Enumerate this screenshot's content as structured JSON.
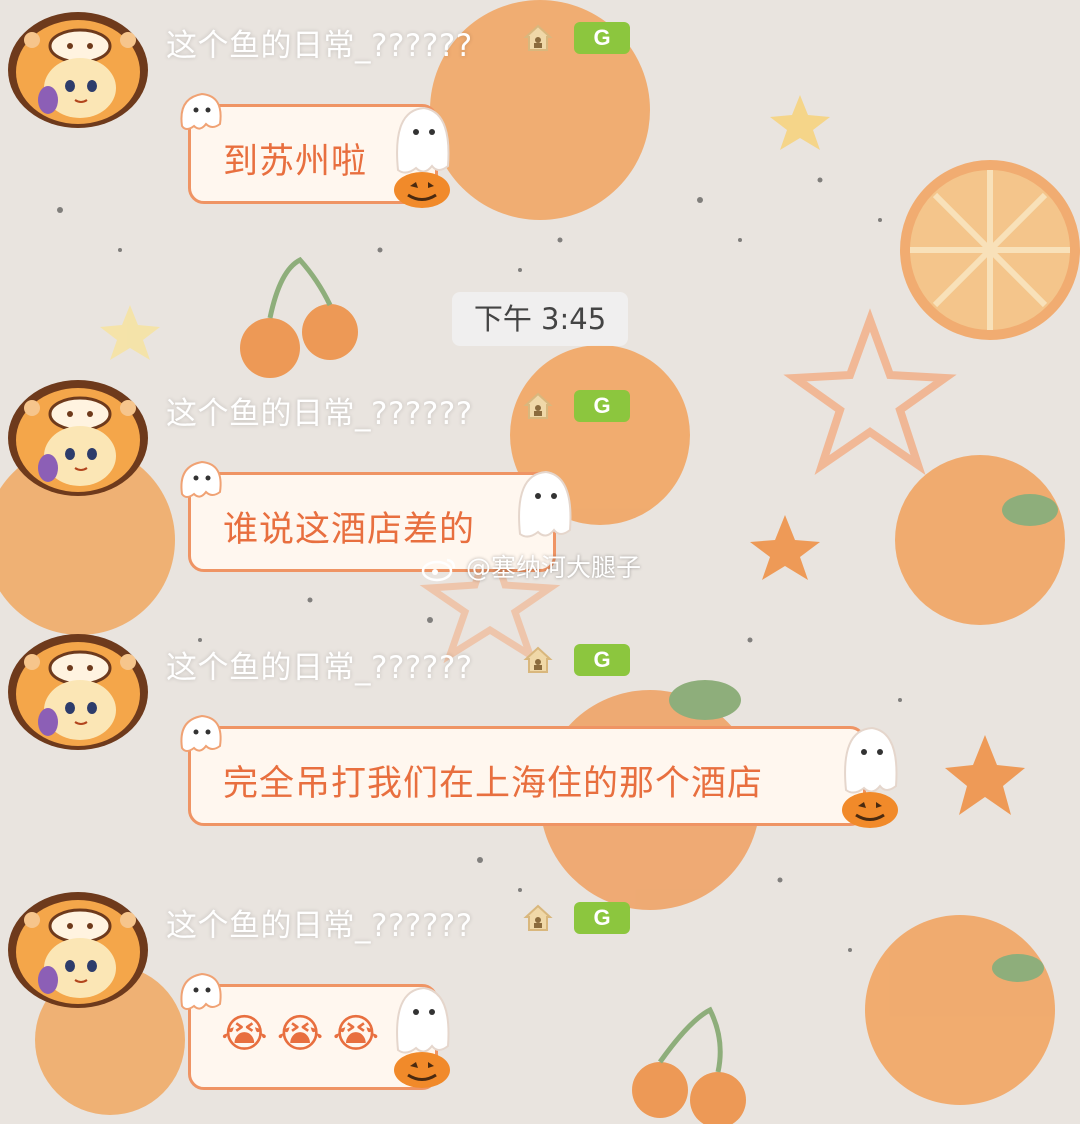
{
  "chat": {
    "timestamp": "下午 3:45",
    "messages": [
      {
        "sender": "这个鱼的日常_??????",
        "level_badge": "G",
        "text": "到苏州啦"
      },
      {
        "sender": "这个鱼的日常_??????",
        "level_badge": "G",
        "text": "谁说这酒店差的"
      },
      {
        "sender": "这个鱼的日常_??????",
        "level_badge": "G",
        "text": "完全吊打我们在上海住的那个酒店"
      },
      {
        "sender": "这个鱼的日常_??????",
        "level_badge": "G",
        "emojis": [
          "😭",
          "😭",
          "😭"
        ]
      }
    ]
  },
  "watermark": {
    "text": "@塞纳河大腿子"
  },
  "icons": {
    "avatar": "costume-avatar-icon",
    "house": "house-icon",
    "bubble_decor": "ghost-pumpkin-icon",
    "emoji": "crying-face-emoji"
  },
  "colors": {
    "bubble_border": "#ef9464",
    "bubble_fill": "#fff7ef",
    "bubble_text": "#e86f3f",
    "badge_green": "#8cc63e",
    "background": "#e9e4df"
  }
}
